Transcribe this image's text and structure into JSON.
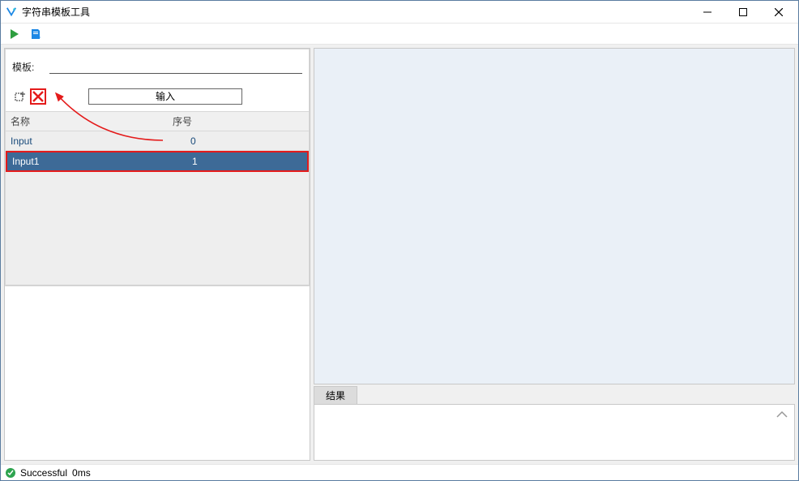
{
  "window": {
    "title": "字符串模板工具"
  },
  "toolbar": {
    "run": "run",
    "export": "export"
  },
  "left": {
    "template_label": "模板:",
    "template_value": "",
    "input_button": "输入",
    "headers": {
      "name": "名称",
      "index": "序号"
    },
    "rows": [
      {
        "name": "Input",
        "index": "0",
        "selected": false
      },
      {
        "name": "Input1",
        "index": "1",
        "selected": true
      }
    ]
  },
  "right": {
    "tab_result": "结果"
  },
  "status": {
    "text": "Successful",
    "time": "0ms"
  }
}
